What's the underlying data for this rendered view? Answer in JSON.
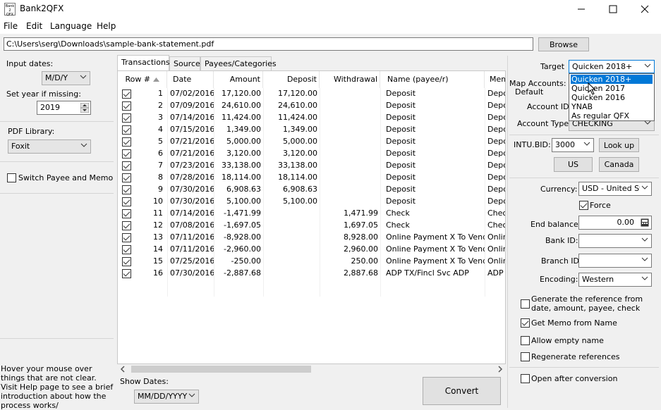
{
  "window": {
    "title": "Bank2QFX",
    "icon_text": "Bank 2 QFX"
  },
  "menu": [
    "File",
    "Edit",
    "Language",
    "Help"
  ],
  "file_path": "C:\\Users\\serg\\Downloads\\sample-bank-statement.pdf",
  "browse_label": "Browse",
  "left": {
    "input_dates_label": "Input dates:",
    "input_dates_value": "M/D/Y",
    "set_year_label": "Set year if missing:",
    "year_value": "2019",
    "pdf_library_label": "PDF Library:",
    "pdf_library_value": "Foxit",
    "switch_label": "Switch Payee and Memo",
    "help_text": "Hover your mouse over things that are not clear. Visit Help page to see a brief introduction about how the process works/"
  },
  "tabs": [
    "Transactions",
    "Source",
    "Payees/Categories"
  ],
  "grid": {
    "columns": [
      "Row #",
      "Date",
      "Amount",
      "Deposit",
      "Withdrawal",
      "Name (payee/r)",
      "Mem"
    ],
    "rows": [
      {
        "n": "1",
        "date": "07/02/2016",
        "amount": "17,120.00",
        "deposit": "17,120.00",
        "withdrawal": "",
        "name": "Deposit",
        "memo": "Depo"
      },
      {
        "n": "2",
        "date": "07/09/2016",
        "amount": "24,610.00",
        "deposit": "24,610.00",
        "withdrawal": "",
        "name": "Deposit",
        "memo": "Depo"
      },
      {
        "n": "3",
        "date": "07/14/2016",
        "amount": "11,424.00",
        "deposit": "11,424.00",
        "withdrawal": "",
        "name": "Deposit",
        "memo": "Depo"
      },
      {
        "n": "4",
        "date": "07/15/2016",
        "amount": "1,349.00",
        "deposit": "1,349.00",
        "withdrawal": "",
        "name": "Deposit",
        "memo": "Depo"
      },
      {
        "n": "5",
        "date": "07/21/2016",
        "amount": "5,000.00",
        "deposit": "5,000.00",
        "withdrawal": "",
        "name": "Deposit",
        "memo": "Depo"
      },
      {
        "n": "6",
        "date": "07/21/2016",
        "amount": "3,120.00",
        "deposit": "3,120.00",
        "withdrawal": "",
        "name": "Deposit",
        "memo": "Depo"
      },
      {
        "n": "7",
        "date": "07/23/2016",
        "amount": "33,138.00",
        "deposit": "33,138.00",
        "withdrawal": "",
        "name": "Deposit",
        "memo": "Depo"
      },
      {
        "n": "8",
        "date": "07/28/2016",
        "amount": "18,114.00",
        "deposit": "18,114.00",
        "withdrawal": "",
        "name": "Deposit",
        "memo": "Depo"
      },
      {
        "n": "9",
        "date": "07/30/2016",
        "amount": "6,908.63",
        "deposit": "6,908.63",
        "withdrawal": "",
        "name": "Deposit",
        "memo": "Depo"
      },
      {
        "n": "10",
        "date": "07/30/2016",
        "amount": "5,100.00",
        "deposit": "5,100.00",
        "withdrawal": "",
        "name": "Deposit",
        "memo": "Depo"
      },
      {
        "n": "11",
        "date": "07/14/2016",
        "amount": "-1,471.99",
        "deposit": "",
        "withdrawal": "1,471.99",
        "name": "Check",
        "memo": "Chec"
      },
      {
        "n": "12",
        "date": "07/08/2016",
        "amount": "-1,697.05",
        "deposit": "",
        "withdrawal": "1,697.05",
        "name": "Check",
        "memo": "Chec"
      },
      {
        "n": "13",
        "date": "07/11/2016",
        "amount": "-8,928.00",
        "deposit": "",
        "withdrawal": "8,928.00",
        "name": "Online Payment X To Vendor",
        "memo": "Onlin"
      },
      {
        "n": "14",
        "date": "07/11/2016",
        "amount": "-2,960.00",
        "deposit": "",
        "withdrawal": "2,960.00",
        "name": "Online Payment X To Vendor",
        "memo": "Onlin"
      },
      {
        "n": "15",
        "date": "07/25/2016",
        "amount": "-250.00",
        "deposit": "",
        "withdrawal": "250.00",
        "name": "Online Payment X To Vendor",
        "memo": "Onlin"
      },
      {
        "n": "16",
        "date": "07/30/2016",
        "amount": "-2,887.68",
        "deposit": "",
        "withdrawal": "2,887.68",
        "name": "ADP TX/Fincl Svc ADP",
        "memo": "ADP T"
      }
    ]
  },
  "bottom": {
    "show_dates_label": "Show Dates:",
    "show_dates_value": "MM/DD/YYYY",
    "convert_label": "Convert"
  },
  "right": {
    "target_label": "Target",
    "target_value": "Quicken 2018+",
    "target_options": [
      "Quicken 2018+",
      "Quicken 2017",
      "Quicken 2016",
      "YNAB",
      "As regular QFX"
    ],
    "map_accounts_label": "Map Accounts:",
    "map_default_label": "Default",
    "account_id_label": "Account ID:",
    "account_type_label": "Account Type:",
    "account_type_value": "CHECKING",
    "intu_bid_label": "INTU.BID:",
    "intu_bid_value": "3000",
    "lookup_label": "Look up",
    "us_label": "US",
    "canada_label": "Canada",
    "currency_label": "Currency:",
    "currency_value": "USD - United Sta",
    "force_label": "Force",
    "end_balance_label": "End balance:",
    "end_balance_value": "0.00",
    "bank_id_label": "Bank ID:",
    "branch_id_label": "Branch ID",
    "encoding_label": "Encoding:",
    "encoding_value": "Western",
    "gen_ref_label": "Generate the reference from date, amount, payee, check",
    "get_memo_label": "Get Memo from Name",
    "allow_empty_label": "Allow empty name",
    "regen_label": "Regenerate references",
    "open_after_label": "Open after conversion"
  }
}
